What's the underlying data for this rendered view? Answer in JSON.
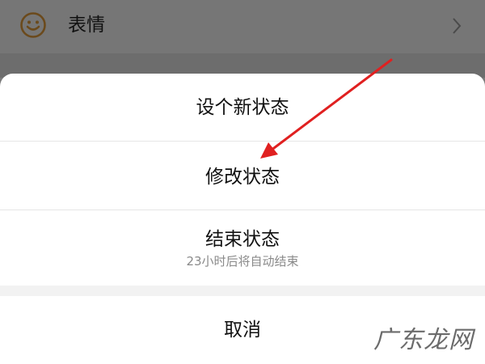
{
  "background_row": {
    "label": "表情",
    "icon": "smiley-face-icon",
    "chevron_icon": "chevron-right-icon"
  },
  "sheet": {
    "options": [
      {
        "label": "设个新状态"
      },
      {
        "label": "修改状态"
      },
      {
        "label": "结束状态",
        "subtitle": "23小时后将自动结束"
      }
    ],
    "cancel_label": "取消"
  },
  "annotation": {
    "arrow_color": "#e02020",
    "points_to": "修改状态"
  },
  "watermark": "广东龙网",
  "colors": {
    "overlay": "#7a7a7a",
    "sheet": "#ffffff",
    "icon_orange": "#8a5a1c"
  }
}
